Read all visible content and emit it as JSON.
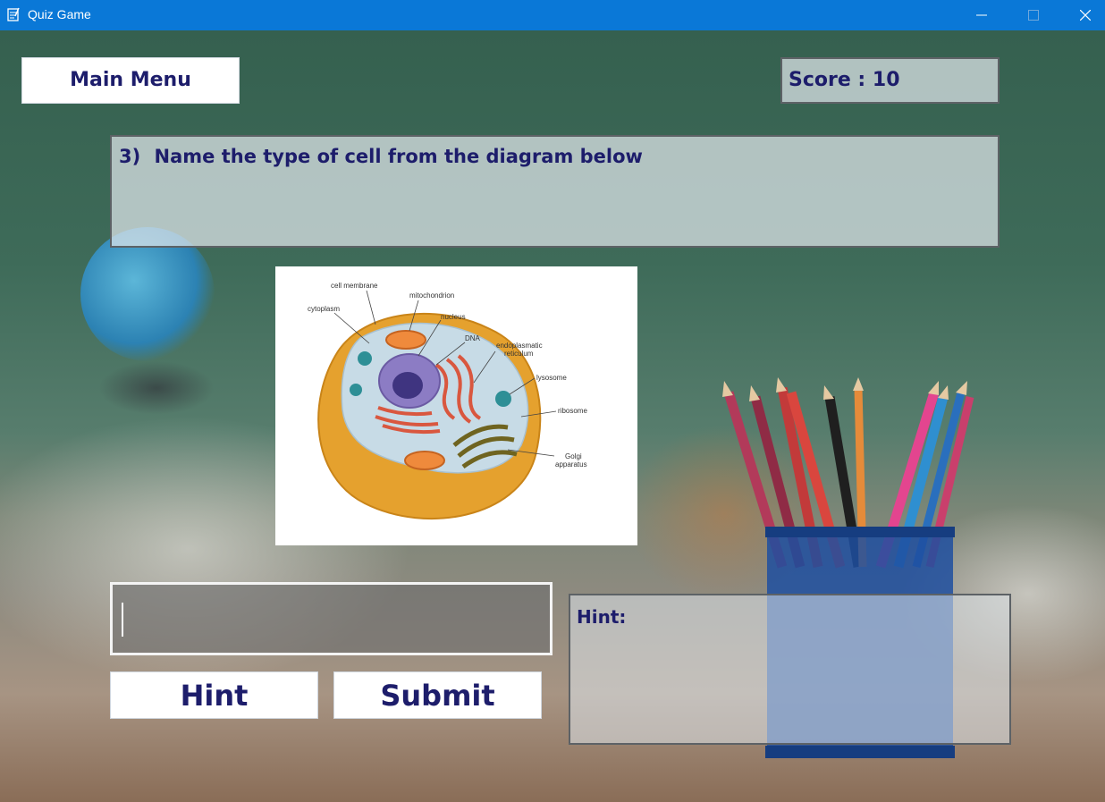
{
  "window": {
    "title": "Quiz Game"
  },
  "main_menu_label": "Main Menu",
  "score": {
    "label": "Score : 10"
  },
  "question": {
    "number": "3)",
    "text": "Name the type of cell from the diagram below"
  },
  "diagram_labels": {
    "cell_membrane": "cell membrane",
    "mitochondrion": "mitochondrion",
    "cytoplasm": "cytoplasm",
    "nucleus": "nucleus",
    "dna": "DNA",
    "er_line1": "endoplasmatic",
    "er_line2": "reticulum",
    "lysosome": "lysosome",
    "ribosome": "ribosome",
    "golgi_line1": "Golgi",
    "golgi_line2": "apparatus"
  },
  "answer_input": {
    "value": ""
  },
  "buttons": {
    "hint": "Hint",
    "submit": "Submit"
  },
  "hint_panel": {
    "label": "Hint:"
  },
  "colors": {
    "titlebar": "#0a78d7",
    "text": "#1d1d6b"
  }
}
